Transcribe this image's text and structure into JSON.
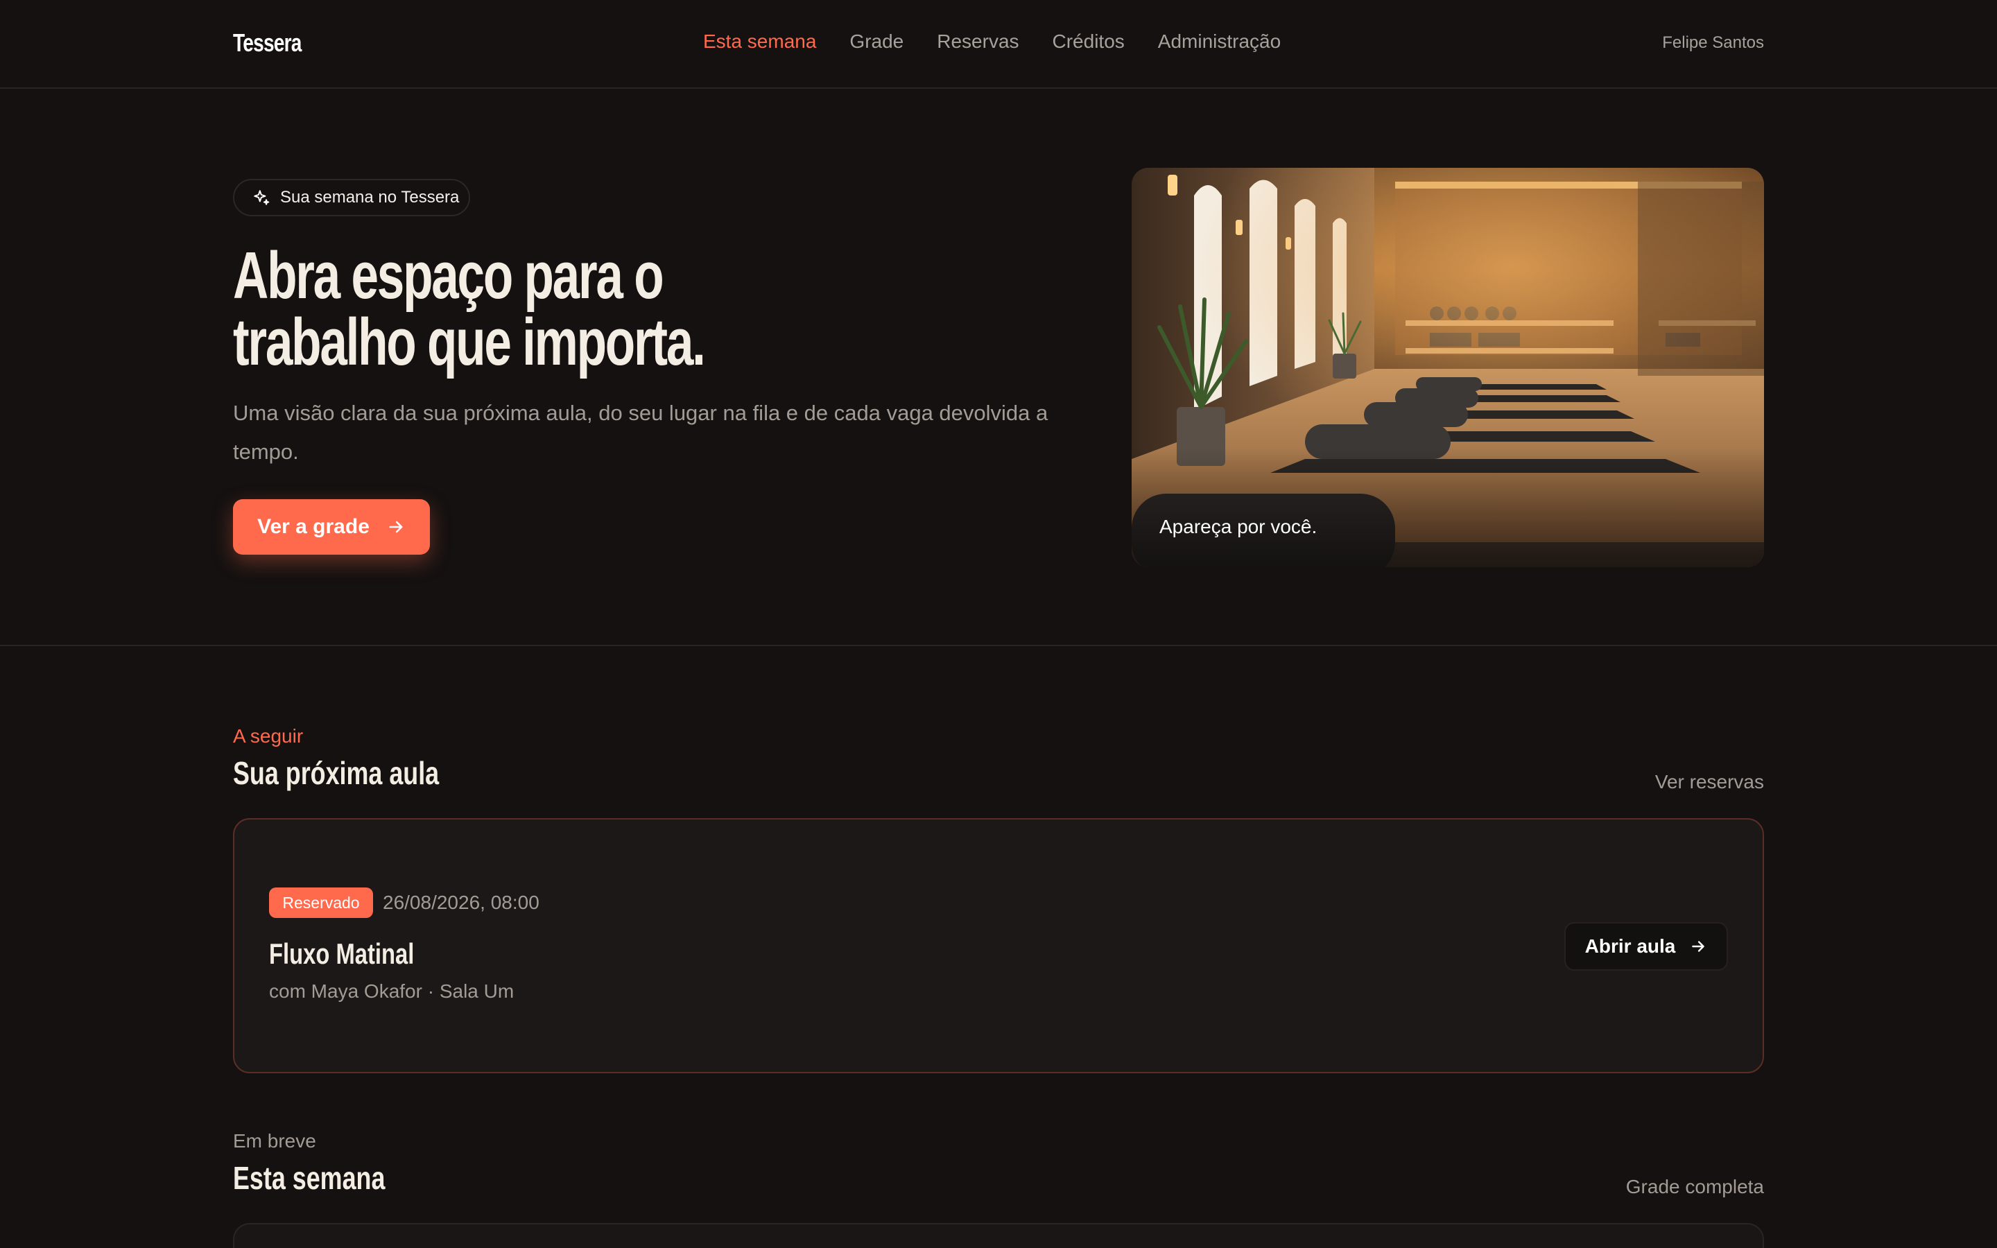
{
  "header": {
    "logo": "Tessera",
    "nav": [
      {
        "label": "Esta semana",
        "active": true
      },
      {
        "label": "Grade",
        "active": false
      },
      {
        "label": "Reservas",
        "active": false
      },
      {
        "label": "Créditos",
        "active": false
      },
      {
        "label": "Administração",
        "active": false
      }
    ],
    "user": "Felipe Santos"
  },
  "hero": {
    "badge": "Sua semana no Tessera",
    "badge_icon": "sparkle-icon",
    "title_line1": "Abra espaço para o",
    "title_line2": "trabalho que importa.",
    "subtitle": "Uma visão clara da sua próxima aula, do seu lugar na fila e de cada vaga devolvida a tempo.",
    "cta_label": "Ver a grade",
    "cta_icon": "arrow-right-icon",
    "image_caption": "Apareça por você."
  },
  "next_class": {
    "eyebrow": "A seguir",
    "title": "Sua próxima aula",
    "link": "Ver reservas",
    "status": "Reservado",
    "datetime": "26/08/2026, 08:00",
    "class_name": "Fluxo Matinal",
    "meta": "com Maya Okafor · Sala Um",
    "open_label": "Abrir aula"
  },
  "week": {
    "eyebrow": "Em breve",
    "title": "Esta semana",
    "link": "Grade completa"
  },
  "colors": {
    "accent": "#ff6a4d",
    "background": "#141110",
    "muted": "#a39b95"
  }
}
